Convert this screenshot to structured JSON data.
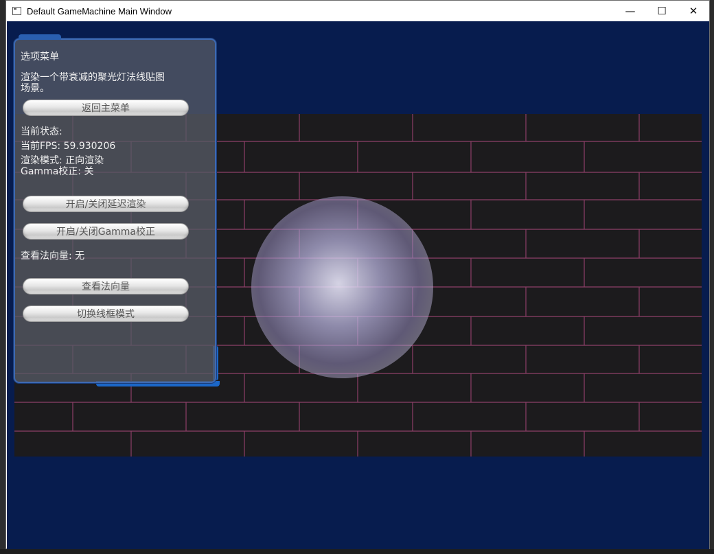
{
  "window": {
    "title": "Default GameMachine Main Window",
    "controls": {
      "minimize": "—",
      "maximize": "☐",
      "close": "✕"
    }
  },
  "menu": {
    "title": "选项菜单",
    "description_line1": "渲染一个带衰减的聚光灯法线贴图",
    "description_line2": "场景。",
    "back_button": "返回主菜单",
    "status_title": "当前状态:",
    "fps_label": "当前FPS: 59.930206",
    "render_mode": "渲染模式: 正向渲染",
    "gamma_status": "Gamma校正: 关",
    "toggle_deferred_button": "开启/关闭延迟渲染",
    "toggle_gamma_button": "开启/关闭Gamma校正",
    "normal_status": "查看法向量: 无",
    "view_normals_button": "查看法向量",
    "wireframe_button": "切换线框模式"
  },
  "colors": {
    "client_bg": "#071c4e",
    "scene_bg": "#1c1b1d",
    "brick_edge": "#c0508a",
    "panel_border": "#3e6ab3"
  },
  "icons": {
    "app": "window-icon",
    "minimize": "minimize-icon",
    "maximize": "maximize-icon",
    "close": "close-icon"
  }
}
